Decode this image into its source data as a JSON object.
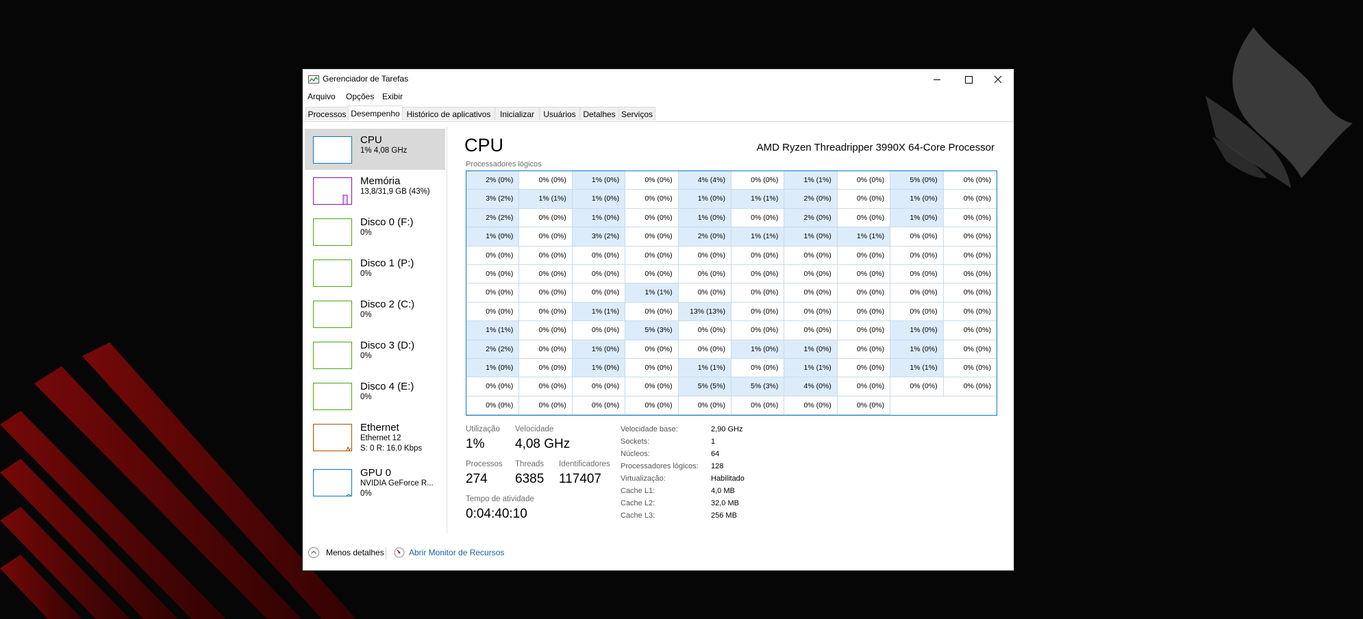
{
  "window": {
    "title": "Gerenciador de Tarefas"
  },
  "menu": [
    "Arquivo",
    "Opções",
    "Exibir"
  ],
  "tabs": [
    "Processos",
    "Desempenho",
    "Histórico de aplicativos",
    "Inicializar",
    "Usuários",
    "Detalhes",
    "Serviços"
  ],
  "active_tab": "Desempenho",
  "sidebar": [
    {
      "name": "CPU",
      "sub1": "1% 4,08 GHz",
      "sub2": "",
      "color": "#1178b7"
    },
    {
      "name": "Memória",
      "sub1": "13,8/31,9 GB (43%)",
      "sub2": "",
      "color": "#8b12ae"
    },
    {
      "name": "Disco 0 (F:)",
      "sub1": "0%",
      "sub2": "",
      "color": "#4da60c"
    },
    {
      "name": "Disco 1 (P:)",
      "sub1": "0%",
      "sub2": "",
      "color": "#4da60c"
    },
    {
      "name": "Disco 2 (C:)",
      "sub1": "0%",
      "sub2": "",
      "color": "#4da60c"
    },
    {
      "name": "Disco 3 (D:)",
      "sub1": "0%",
      "sub2": "",
      "color": "#4da60c"
    },
    {
      "name": "Disco 4 (E:)",
      "sub1": "0%",
      "sub2": "",
      "color": "#4da60c"
    },
    {
      "name": "Ethernet",
      "sub1": "Ethernet 12",
      "sub2": "S: 0 R: 16,0 Kbps",
      "color": "#a74f01"
    },
    {
      "name": "GPU 0",
      "sub1": "NVIDIA GeForce R...",
      "sub2": "0%",
      "color": "#1178b7"
    }
  ],
  "cpu": {
    "title": "CPU",
    "model": "AMD Ryzen Threadripper 3990X 64-Core Processor",
    "grid_caption": "Processadores lógicos",
    "cells": [
      "2% (0%)",
      "0% (0%)",
      "1% (0%)",
      "0% (0%)",
      "4% (4%)",
      "0% (0%)",
      "1% (1%)",
      "0% (0%)",
      "5% (0%)",
      "0% (0%)",
      "3% (2%)",
      "1% (1%)",
      "1% (0%)",
      "0% (0%)",
      "1% (0%)",
      "1% (1%)",
      "2% (0%)",
      "0% (0%)",
      "1% (0%)",
      "0% (0%)",
      "2% (2%)",
      "0% (0%)",
      "1% (0%)",
      "0% (0%)",
      "1% (0%)",
      "0% (0%)",
      "2% (0%)",
      "0% (0%)",
      "1% (0%)",
      "0% (0%)",
      "1% (0%)",
      "0% (0%)",
      "3% (2%)",
      "0% (0%)",
      "2% (0%)",
      "1% (1%)",
      "1% (0%)",
      "1% (1%)",
      "0% (0%)",
      "0% (0%)",
      "0% (0%)",
      "0% (0%)",
      "0% (0%)",
      "0% (0%)",
      "0% (0%)",
      "0% (0%)",
      "0% (0%)",
      "0% (0%)",
      "0% (0%)",
      "0% (0%)",
      "0% (0%)",
      "0% (0%)",
      "0% (0%)",
      "0% (0%)",
      "0% (0%)",
      "0% (0%)",
      "0% (0%)",
      "0% (0%)",
      "0% (0%)",
      "0% (0%)",
      "0% (0%)",
      "0% (0%)",
      "0% (0%)",
      "1% (1%)",
      "0% (0%)",
      "0% (0%)",
      "0% (0%)",
      "0% (0%)",
      "0% (0%)",
      "0% (0%)",
      "0% (0%)",
      "0% (0%)",
      "1% (1%)",
      "0% (0%)",
      "13% (13%)",
      "0% (0%)",
      "0% (0%)",
      "0% (0%)",
      "0% (0%)",
      "0% (0%)",
      "1% (1%)",
      "0% (0%)",
      "0% (0%)",
      "5% (3%)",
      "0% (0%)",
      "0% (0%)",
      "0% (0%)",
      "0% (0%)",
      "1% (0%)",
      "0% (0%)",
      "2% (2%)",
      "0% (0%)",
      "1% (0%)",
      "0% (0%)",
      "0% (0%)",
      "1% (0%)",
      "1% (0%)",
      "0% (0%)",
      "1% (0%)",
      "0% (0%)",
      "1% (0%)",
      "0% (0%)",
      "1% (0%)",
      "0% (0%)",
      "1% (1%)",
      "0% (0%)",
      "1% (1%)",
      "0% (0%)",
      "1% (1%)",
      "0% (0%)",
      "0% (0%)",
      "0% (0%)",
      "0% (0%)",
      "0% (0%)",
      "5% (5%)",
      "5% (3%)",
      "4% (0%)",
      "0% (0%)",
      "0% (0%)",
      "0% (0%)",
      "0% (0%)",
      "0% (0%)",
      "0% (0%)",
      "0% (0%)",
      "0% (0%)",
      "0% (0%)",
      "0% (0%)",
      "0% (0%)"
    ],
    "stats": {
      "util_label": "Utilização",
      "util_value": "1%",
      "speed_label": "Velocidade",
      "speed_value": "4,08 GHz",
      "proc_label": "Processos",
      "proc_value": "274",
      "threads_label": "Threads",
      "threads_value": "6385",
      "handles_label": "Identificadores",
      "handles_value": "117407",
      "uptime_label": "Tempo de atividade",
      "uptime_value": "0:04:40:10"
    },
    "details": [
      {
        "k": "Velocidade base:",
        "v": "2,90 GHz"
      },
      {
        "k": "Sockets:",
        "v": "1"
      },
      {
        "k": "Núcleos:",
        "v": "64"
      },
      {
        "k": "Processadores lógicos:",
        "v": "128"
      },
      {
        "k": "Virtualização:",
        "v": "Habilitado"
      },
      {
        "k": "Cache L1:",
        "v": "4,0 MB"
      },
      {
        "k": "Cache L2:",
        "v": "32,0 MB"
      },
      {
        "k": "Cache L3:",
        "v": "256 MB"
      }
    ]
  },
  "footer": {
    "less_details": "Menos detalhes",
    "open_monitor": "Abrir Monitor de Recursos"
  },
  "colors": {
    "accent": "#1178b7",
    "cell_highlight": "#dcecfa",
    "link": "#1a5fa5"
  }
}
